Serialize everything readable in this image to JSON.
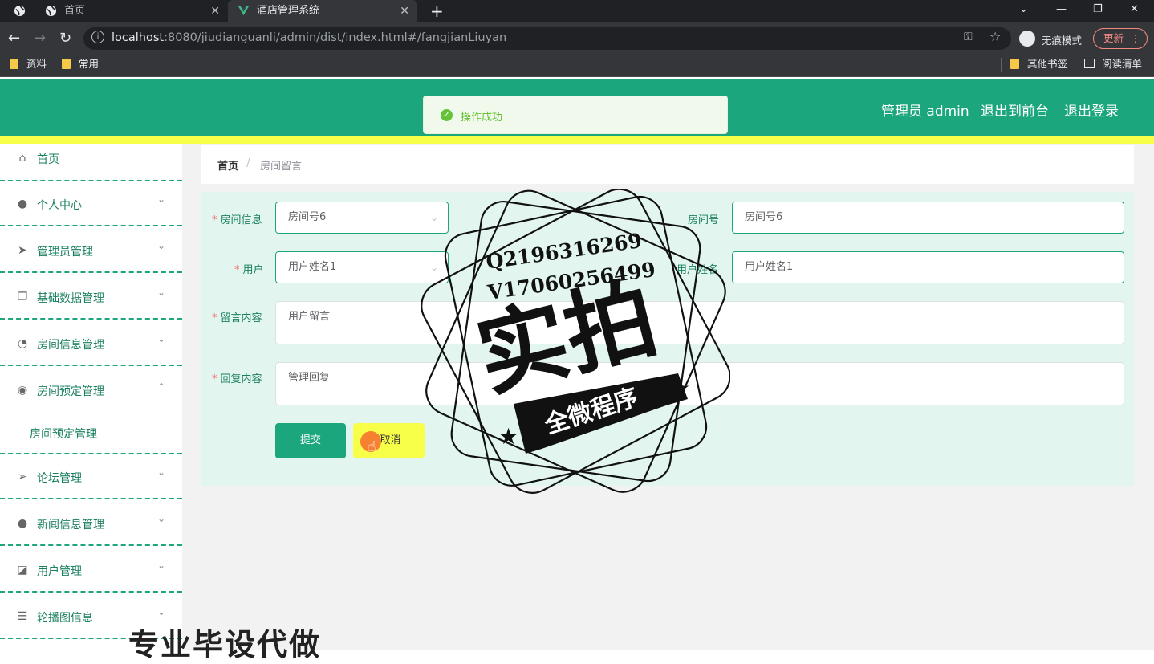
{
  "browser": {
    "tabs": [
      {
        "title": ""
      },
      {
        "title": "首页"
      },
      {
        "title": "酒店管理系统"
      }
    ],
    "new_tab": "+",
    "url_host": "localhost",
    "url_rest": ":8080/jiudianguanli/admin/dist/index.html#/fangjianLiuyan",
    "incognito_label": "无痕模式",
    "update_label": "更新",
    "bookmarks": [
      "资料",
      "常用"
    ],
    "bookmarks_right": [
      "其他书签",
      "阅读清单"
    ]
  },
  "header": {
    "user_label": "管理员 admin",
    "front_link": "退出到前台",
    "logout_link": "退出登录",
    "toast": "操作成功",
    "brand_color": "#1ca67d",
    "accent_color": "#f8ff49"
  },
  "sidebar": {
    "items": [
      {
        "label": "首页",
        "icon": "home-icon"
      },
      {
        "label": "个人中心",
        "icon": "user-icon"
      },
      {
        "label": "管理员管理",
        "icon": "send-icon"
      },
      {
        "label": "基础数据管理",
        "icon": "copy-icon"
      },
      {
        "label": "房间信息管理",
        "icon": "gauge-icon"
      },
      {
        "label": "房间预定管理",
        "icon": "bulb-icon"
      },
      {
        "label": "房间预定管理",
        "icon": ""
      },
      {
        "label": "论坛管理",
        "icon": "navigation-icon"
      },
      {
        "label": "新闻信息管理",
        "icon": "user-icon"
      },
      {
        "label": "用户管理",
        "icon": "chart-icon"
      },
      {
        "label": "轮播图信息",
        "icon": "list-icon"
      }
    ]
  },
  "breadcrumb": {
    "home": "首页",
    "separator": "/",
    "current": "房间留言"
  },
  "form": {
    "room_info_label": "房间信息",
    "room_info_value": "房间号6",
    "room_no_label": "房间号",
    "room_no_value": "房间号6",
    "user_label": "用户",
    "user_value": "用户姓名1",
    "user_name_label": "用户姓名",
    "user_name_value": "用户姓名1",
    "message_label": "留言内容",
    "message_value": "用户留言",
    "reply_label": "回复内容",
    "reply_value": "管理回复",
    "submit": "提交",
    "cancel": "取消"
  },
  "watermark": {
    "qq": "Q2196316269",
    "vx": "V17060256499",
    "main": "实拍",
    "ribbon": "全微程序",
    "bottom": "专业毕设代做"
  }
}
